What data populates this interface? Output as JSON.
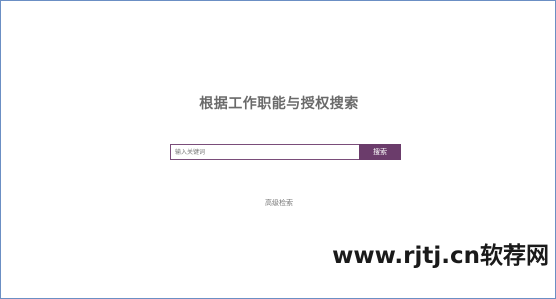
{
  "page": {
    "title": "根据工作职能与授权搜索"
  },
  "search": {
    "placeholder": "输入关键词",
    "button_label": "搜索"
  },
  "advanced_search": {
    "label": "高级检索"
  },
  "watermark": {
    "text": "www.rjtj.cn软荐网"
  },
  "colors": {
    "accent": "#6b3c6b",
    "frame_border": "#6b8fc4"
  }
}
